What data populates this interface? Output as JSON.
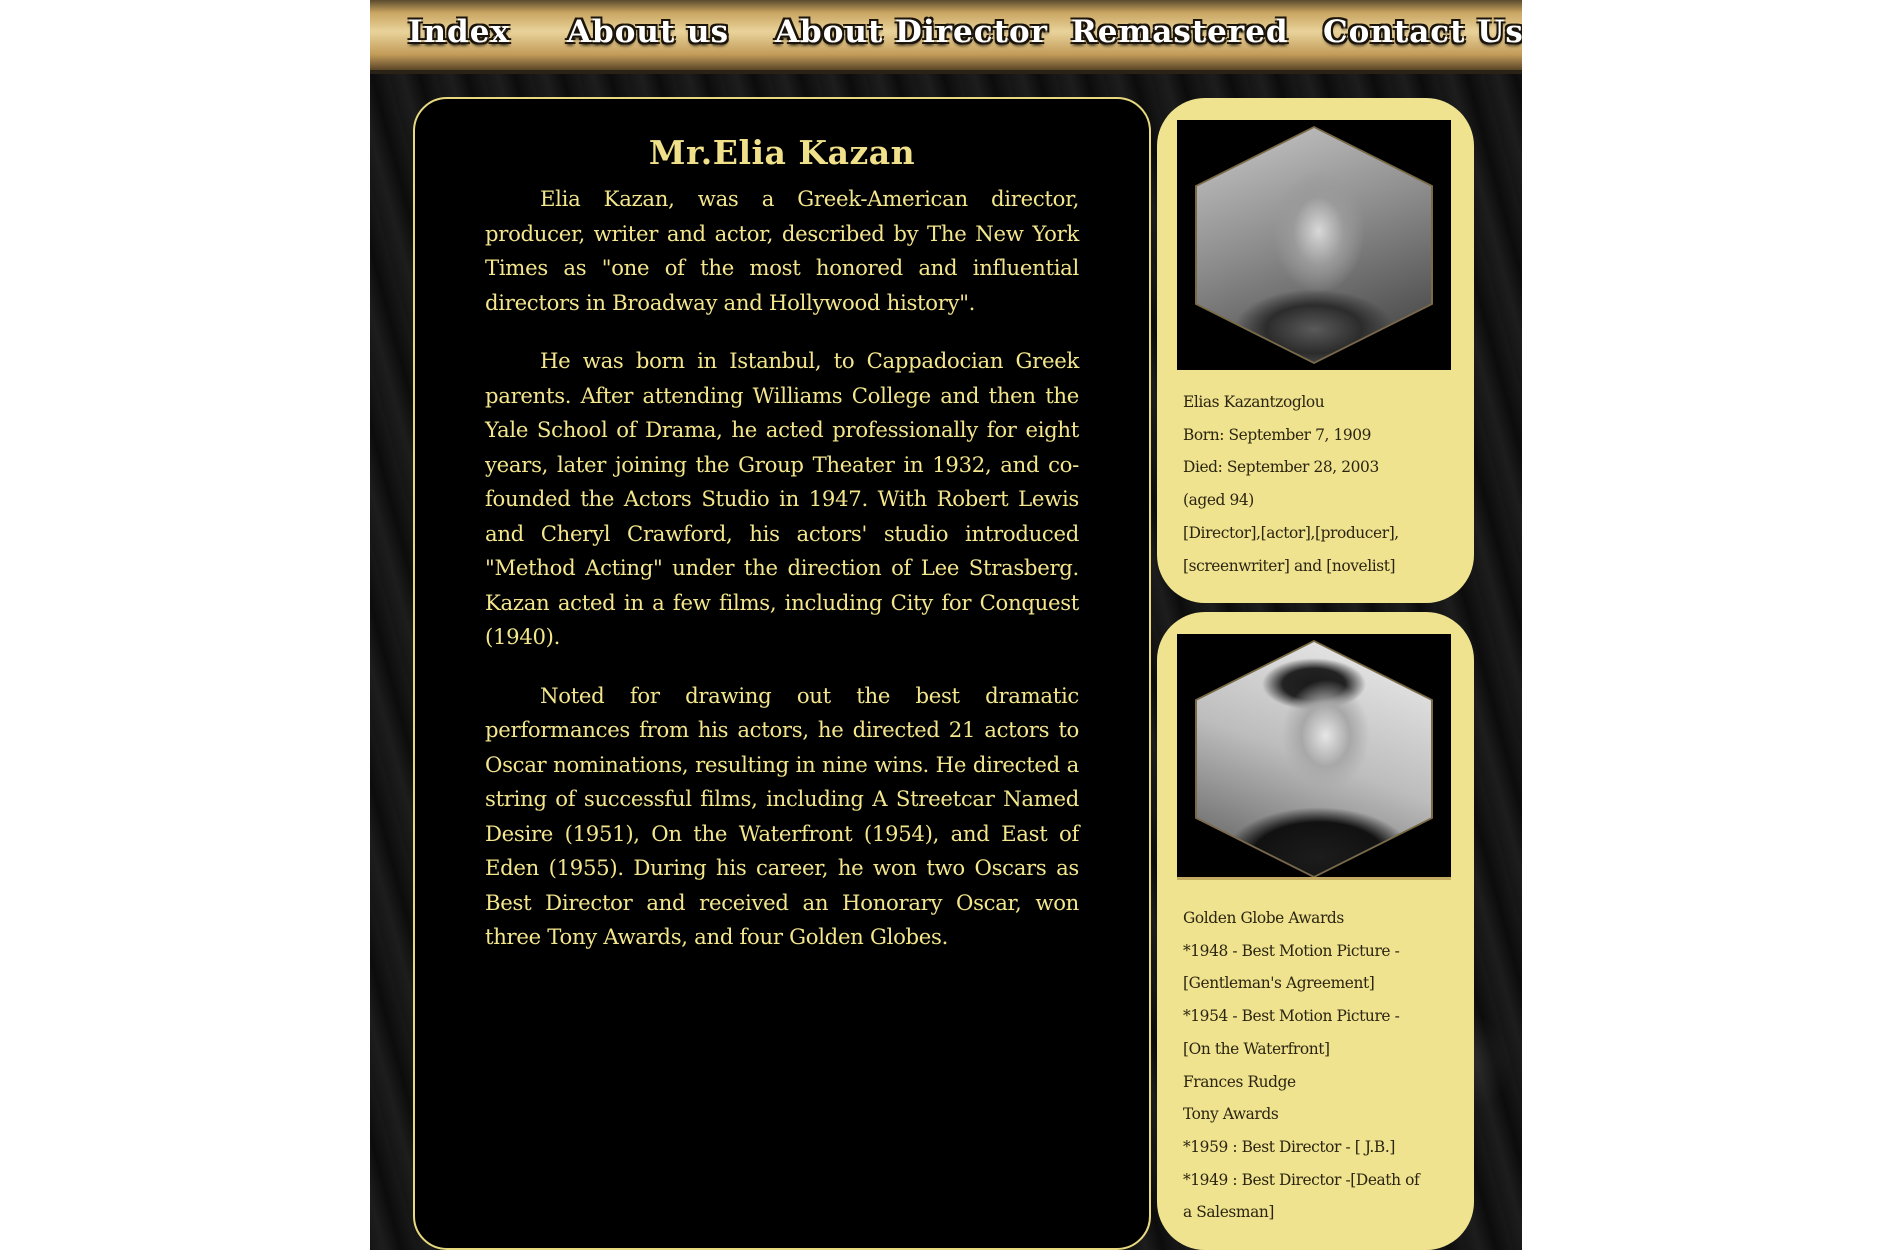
{
  "nav": {
    "items": [
      "Index",
      "About us",
      "About Director",
      "Remastered",
      "Contact Us"
    ]
  },
  "main": {
    "title": "Mr.Elia Kazan",
    "paragraphs": [
      "Elia Kazan, was a Greek-American director, producer, writer and actor, described by The New York Times as \"one of the most honored and influential directors in Broadway and Hollywood history\".",
      "He was born in Istanbul, to Cappadocian Greek parents. After attending Williams College and then the Yale School of Drama, he acted professionally for eight years, later joining the Group Theater in 1932, and co-founded the Actors Studio in 1947. With Robert Lewis and Cheryl Crawford, his actors' studio introduced \"Method Acting\" under the direction of Lee Strasberg. Kazan acted in a few films, including City for Conquest (1940).",
      "Noted for drawing out the best dramatic performances from his actors, he directed 21 actors to Oscar nominations, resulting in nine wins. He directed a string of successful films, including A Streetcar Named Desire (1951), On the Waterfront (1954), and East of Eden (1955). During his career, he won two Oscars as Best Director and received an Honorary Oscar, won three Tony Awards, and four Golden Globes."
    ]
  },
  "sidebar": {
    "card1": {
      "lines": [
        "Elias Kazantzoglou",
        "Born: September 7, 1909",
        "Died: September 28, 2003",
        "(aged 94)",
        "[Director],[actor],[producer],",
        "[screenwriter] and [novelist]"
      ]
    },
    "card2": {
      "lines": [
        "Golden Globe Awards",
        "*1948 - Best Motion Picture -",
        "[Gentleman's Agreement]",
        "*1954 - Best Motion Picture -",
        "[On the Waterfront]",
        "Frances Rudge",
        "Tony Awards",
        "*1959 : Best Director - [ J.B.]",
        "*1949 : Best Director -[Death of",
        "a Salesman]"
      ]
    }
  },
  "colors": {
    "accent_text": "#f3e68c",
    "card_background": "#efe38f",
    "nav_gold": "#c9a561"
  }
}
